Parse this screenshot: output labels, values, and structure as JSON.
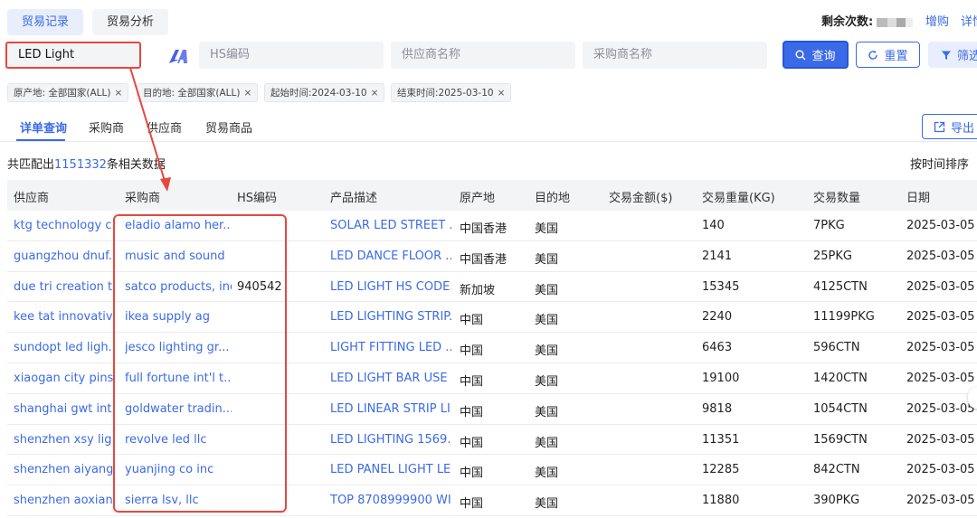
{
  "header": {
    "tabs": [
      {
        "label": "贸易记录"
      },
      {
        "label": "贸易分析"
      }
    ],
    "remaining_label": "剩余次数:",
    "buy_label": "增购",
    "detail_label": "详情"
  },
  "search": {
    "keyword": "LED Light",
    "hs_placeholder": "HS编码",
    "supplier_placeholder": "供应商名称",
    "buyer_placeholder": "采购商名称",
    "query_label": "查询",
    "reset_label": "重置",
    "filter_label": "筛选"
  },
  "chips": [
    {
      "label": "原产地: 全部国家(ALL)"
    },
    {
      "label": "目的地: 全部国家(ALL)"
    },
    {
      "label": "起始时间:2024-03-10"
    },
    {
      "label": "结束时间:2025-03-10"
    }
  ],
  "subtabs": [
    {
      "label": "详单查询"
    },
    {
      "label": "采购商"
    },
    {
      "label": "供应商"
    },
    {
      "label": "贸易商品"
    }
  ],
  "export_label": "导出",
  "summary": {
    "prefix": "共匹配出",
    "count": "1151332",
    "suffix": "条相关数据"
  },
  "sort_label": "按时间排序",
  "table": {
    "columns": [
      "供应商",
      "采购商",
      "HS编码",
      "产品描述",
      "原产地",
      "目的地",
      "交易金额($)",
      "交易重量(KG)",
      "交易数量",
      "日期"
    ],
    "rows": [
      [
        "ktg technology c...",
        "eladio alamo her...",
        "",
        "SOLAR LED STREET ...",
        "中国香港",
        "美国",
        "",
        "140",
        "7PKG",
        "2025-03-05"
      ],
      [
        "guangzhou dnuf...",
        "music and sound",
        "",
        "LED DANCE FLOOR ...",
        "中国香港",
        "美国",
        "",
        "2141",
        "25PKG",
        "2025-03-05"
      ],
      [
        "due tri creation t...",
        "satco products, inc",
        "940542",
        "LED LIGHT HS CODE...",
        "新加坡",
        "美国",
        "",
        "15345",
        "4125CTN",
        "2025-03-05"
      ],
      [
        "kee tat innovativ...",
        "ikea supply ag",
        "",
        "LED LIGHTING STRIP...",
        "中国",
        "美国",
        "",
        "2240",
        "11199PKG",
        "2025-03-05"
      ],
      [
        "sundopt led ligh...",
        "jesco lighting gr...",
        "",
        "LIGHT FITTING LED ...",
        "中国",
        "美国",
        "",
        "6463",
        "596CTN",
        "2025-03-05"
      ],
      [
        "xiaogan city pins...",
        "full fortune int'l t...",
        "",
        "LED LIGHT BAR USE ...",
        "中国",
        "美国",
        "",
        "19100",
        "1420CTN",
        "2025-03-05"
      ],
      [
        "shanghai gwt int...",
        "goldwater tradin...",
        "",
        "LED LINEAR STRIP LI...",
        "中国",
        "美国",
        "",
        "9818",
        "1054CTN",
        "2025-03-05"
      ],
      [
        "shenzhen xsy lig...",
        "revolve led llc",
        "",
        "LED LIGHTING 1569...",
        "中国",
        "美国",
        "",
        "11351",
        "1569CTN",
        "2025-03-05"
      ],
      [
        "shenzhen aiyang...",
        "yuanjing co inc",
        "",
        "LED PANEL LIGHT LED",
        "中国",
        "美国",
        "",
        "12285",
        "842CTN",
        "2025-03-05"
      ],
      [
        "shenzhen aoxian...",
        "sierra lsv, llc",
        "",
        "TOP 8708999900 WI...",
        "中国",
        "美国",
        "",
        "11880",
        "390PKG",
        "2025-03-05"
      ]
    ]
  },
  "colors": {
    "accent": "#3b6ae8",
    "highlight": "#e5483f"
  },
  "icons": [
    "ai-logo-icon",
    "search-icon",
    "refresh-icon",
    "funnel-icon",
    "export-icon",
    "close-icon"
  ]
}
